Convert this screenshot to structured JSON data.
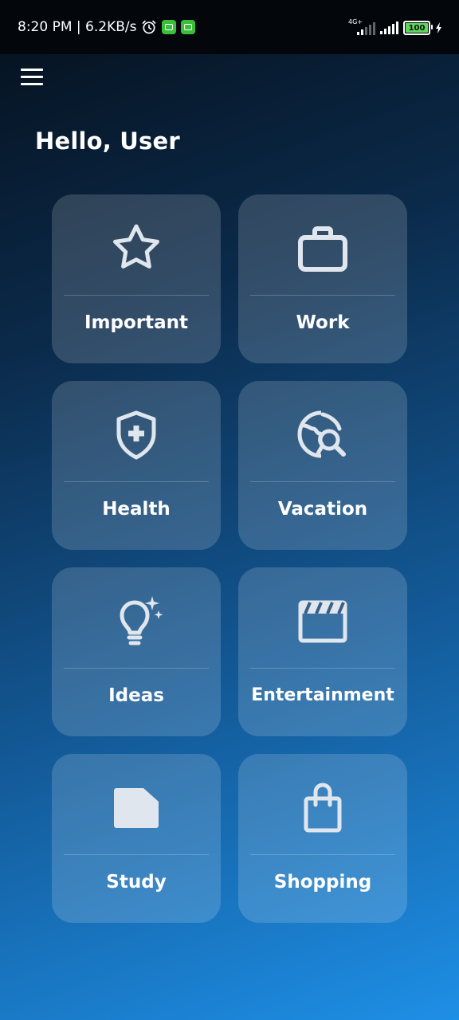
{
  "status_bar": {
    "time": "8:20 PM | 6.2KB/s",
    "network_type": "4G+",
    "battery": "100"
  },
  "header": {
    "menu_icon": "hamburger-menu-icon",
    "greeting": "Hello, User"
  },
  "categories": [
    {
      "label": "Important",
      "icon": "star-icon"
    },
    {
      "label": "Work",
      "icon": "briefcase-icon"
    },
    {
      "label": "Health",
      "icon": "shield-cross-icon"
    },
    {
      "label": "Vacation",
      "icon": "globe-search-icon"
    },
    {
      "label": "Ideas",
      "icon": "lightbulb-sparkle-icon"
    },
    {
      "label": "Entertainment",
      "icon": "clapperboard-icon"
    },
    {
      "label": "Study",
      "icon": "document-icon"
    },
    {
      "label": "Shopping",
      "icon": "shopping-bag-icon"
    }
  ],
  "colors": {
    "background_top": "#05101c",
    "background_bottom": "#1e8fe6",
    "card_fill": "rgba(255,255,255,0.16)",
    "icon_color": "#dfe6ee"
  }
}
